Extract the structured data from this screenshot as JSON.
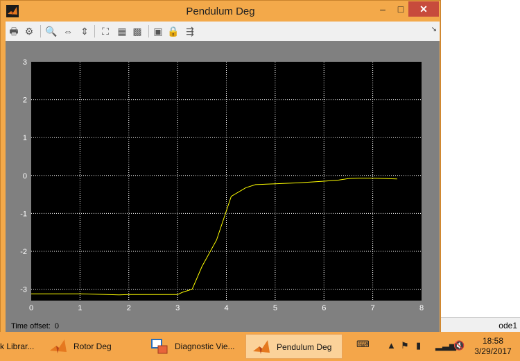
{
  "window": {
    "title": "Pendulum Deg",
    "minimize_glyph": "–",
    "maximize_glyph": "□",
    "close_glyph": "✕"
  },
  "toolbar": {
    "icons": [
      "print-icon",
      "gear-icon",
      "zoom-icon",
      "zoom-x-icon",
      "zoom-y-icon",
      "autoscale-icon",
      "save-axes-icon",
      "restore-axes-icon",
      "floating-scope-icon",
      "lock-icon",
      "signal-selection-icon"
    ]
  },
  "scope": {
    "time_offset_label": "Time offset:",
    "time_offset_value": "0"
  },
  "chart_data": {
    "type": "line",
    "xlim": [
      0,
      8
    ],
    "ylim": [
      -3.3,
      3
    ],
    "x_ticks": [
      0,
      1,
      2,
      3,
      4,
      5,
      6,
      7,
      8
    ],
    "y_ticks": [
      3,
      2,
      1,
      0,
      -1,
      -2,
      -3
    ],
    "x_tick_labels": [
      "0",
      "1",
      "2",
      "3",
      "4",
      "5",
      "6",
      "7",
      "8"
    ],
    "y_tick_labels": [
      "3",
      "2",
      "1",
      "0",
      "-1",
      "-2",
      "-3"
    ],
    "grid": true,
    "background": "#000000",
    "line_color": "#ffff00",
    "series": [
      {
        "x": [
          0,
          1.0,
          1.8,
          2.0,
          3.0,
          3.1,
          3.3,
          3.5,
          3.8,
          4.1,
          4.4,
          4.6,
          5.0,
          5.5,
          6.0,
          6.3,
          6.5,
          6.7,
          7.0,
          7.5
        ],
        "y": [
          -3.12,
          -3.12,
          -3.15,
          -3.14,
          -3.14,
          -3.08,
          -3.0,
          -2.4,
          -1.7,
          -0.55,
          -0.32,
          -0.24,
          -0.22,
          -0.19,
          -0.15,
          -0.12,
          -0.08,
          -0.07,
          -0.07,
          -0.09
        ]
      }
    ]
  },
  "background_app": {
    "status_text": "ode1"
  },
  "taskbar": {
    "items": [
      {
        "label": "k Librar...",
        "active": false
      },
      {
        "label": "Rotor Deg",
        "active": false
      },
      {
        "label": "Diagnostic Vie...",
        "active": false
      },
      {
        "label": "Pendulum Deg",
        "active": true
      }
    ],
    "clock_time": "18:58",
    "clock_date": "3/29/2017"
  },
  "colors": {
    "window_frame": "#f3a94a",
    "close_button": "#c74b3c",
    "scope_bg": "#808080",
    "plot_bg": "#000000",
    "grid": "#ffffff",
    "taskbar": "#f4a64a"
  }
}
